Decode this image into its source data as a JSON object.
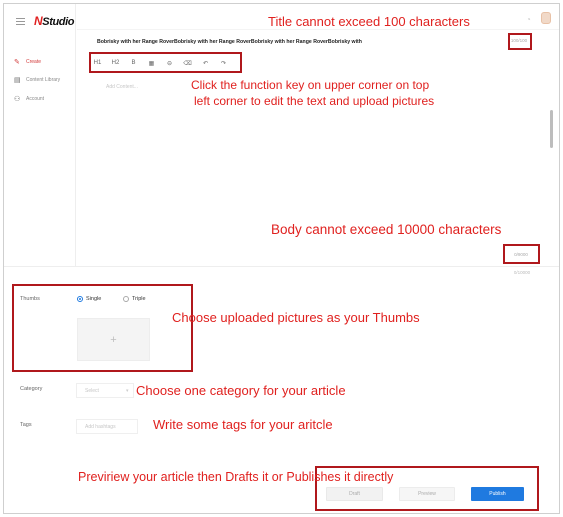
{
  "app": {
    "logo_text": "Studio",
    "logo_mark": "N"
  },
  "sidebar": {
    "items": [
      {
        "label": "Create",
        "icon": "pencil-icon",
        "active": true
      },
      {
        "label": "Content Library",
        "icon": "library-icon",
        "active": false
      },
      {
        "label": "Account",
        "icon": "account-icon",
        "active": false
      }
    ]
  },
  "header": {
    "notification_icon": "bell-icon",
    "avatar_icon": "user-avatar"
  },
  "editor": {
    "title": "Bobrisky with her Range RoverBobrisky with her Range RoverBobrisky with her Range RoverBobrisky with",
    "title_count": "100/100",
    "toolbar": [
      {
        "label": "H1",
        "icon": "heading1-icon"
      },
      {
        "label": "H2",
        "icon": "heading2-icon"
      },
      {
        "label": "B",
        "icon": "bold-icon"
      },
      {
        "label": "▦",
        "icon": "image-icon"
      },
      {
        "label": "⊖",
        "icon": "link-icon"
      },
      {
        "label": "⌫",
        "icon": "eraser-icon"
      },
      {
        "label": "↶",
        "icon": "undo-icon"
      },
      {
        "label": "↷",
        "icon": "redo-icon"
      }
    ],
    "body_placeholder": "Add Content...",
    "body_count": "0/9000",
    "body_total": "0/10000"
  },
  "form": {
    "thumbs_label": "Thumbs",
    "thumb_options": [
      {
        "label": "Single",
        "selected": true
      },
      {
        "label": "Triple",
        "selected": false
      }
    ],
    "upload_symbol": "+",
    "category_label": "Category",
    "category_placeholder": "Select",
    "tags_label": "Tags",
    "tags_placeholder": "Add hashtags"
  },
  "actions": {
    "draft": "Draft",
    "preview": "Preview",
    "publish": "Publish"
  },
  "annotations": {
    "title_limit": "Title cannot exceed 100      characters",
    "function_keys_1": "Click the function key on upper corner on top",
    "function_keys_2": "left corner to edit the text and upload pictures",
    "body_limit": "Body cannot exceed 10000 characters",
    "thumbs_hint": "Choose uploaded pictures as your Thumbs",
    "category_hint": "Choose one category for your article",
    "tags_hint": "Write some tags for your aritcle",
    "publish_hint": "Previriew your article then Drafts it or Publishes it directly"
  },
  "colors": {
    "accent": "#1f7ae0",
    "annotation": "#e0211f",
    "annotation_box": "#b0181c",
    "active_menu": "#d23a3a"
  }
}
